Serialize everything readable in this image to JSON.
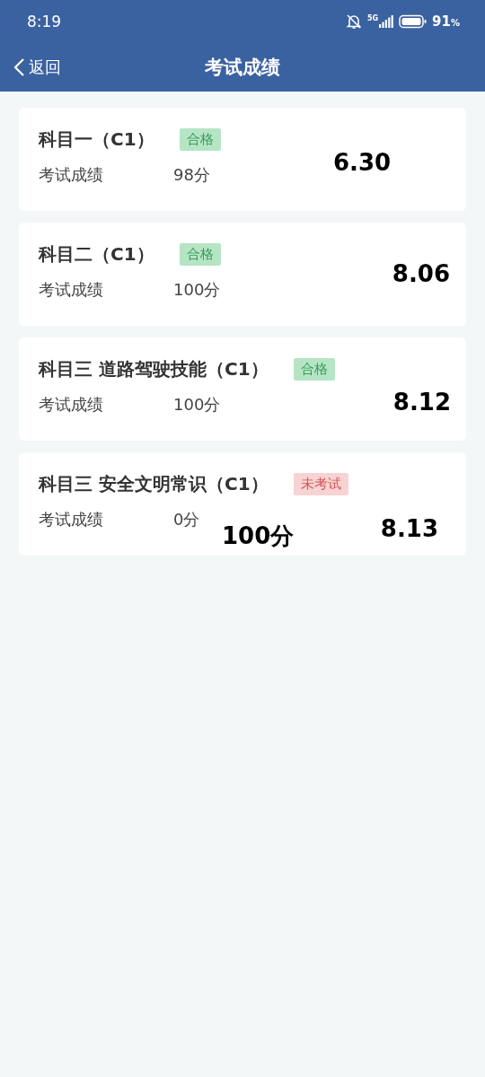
{
  "status_bar": {
    "time": "8:19",
    "network": "5G",
    "battery": "91",
    "battery_unit": "%"
  },
  "header": {
    "back": "返回",
    "title": "考试成绩"
  },
  "cards": [
    {
      "title": "科目一（C1）",
      "tag": {
        "text": "合格",
        "kind": "pass"
      },
      "label": "考试成绩",
      "score": "98分",
      "notes": [
        "6.30"
      ]
    },
    {
      "title": "科目二（C1）",
      "tag": {
        "text": "合格",
        "kind": "pass"
      },
      "label": "考试成绩",
      "score": "100分",
      "notes": [
        "8.06"
      ]
    },
    {
      "title": "科目三 道路驾驶技能（C1）",
      "tag": {
        "text": "合格",
        "kind": "pass"
      },
      "label": "考试成绩",
      "score": "100分",
      "notes": [
        "8.12"
      ]
    },
    {
      "title": "科目三 安全文明常识（C1）",
      "tag": {
        "text": "未考试",
        "kind": "pending"
      },
      "label": "考试成绩",
      "score": "0分",
      "notes": [
        "100分",
        "8.13"
      ]
    }
  ]
}
